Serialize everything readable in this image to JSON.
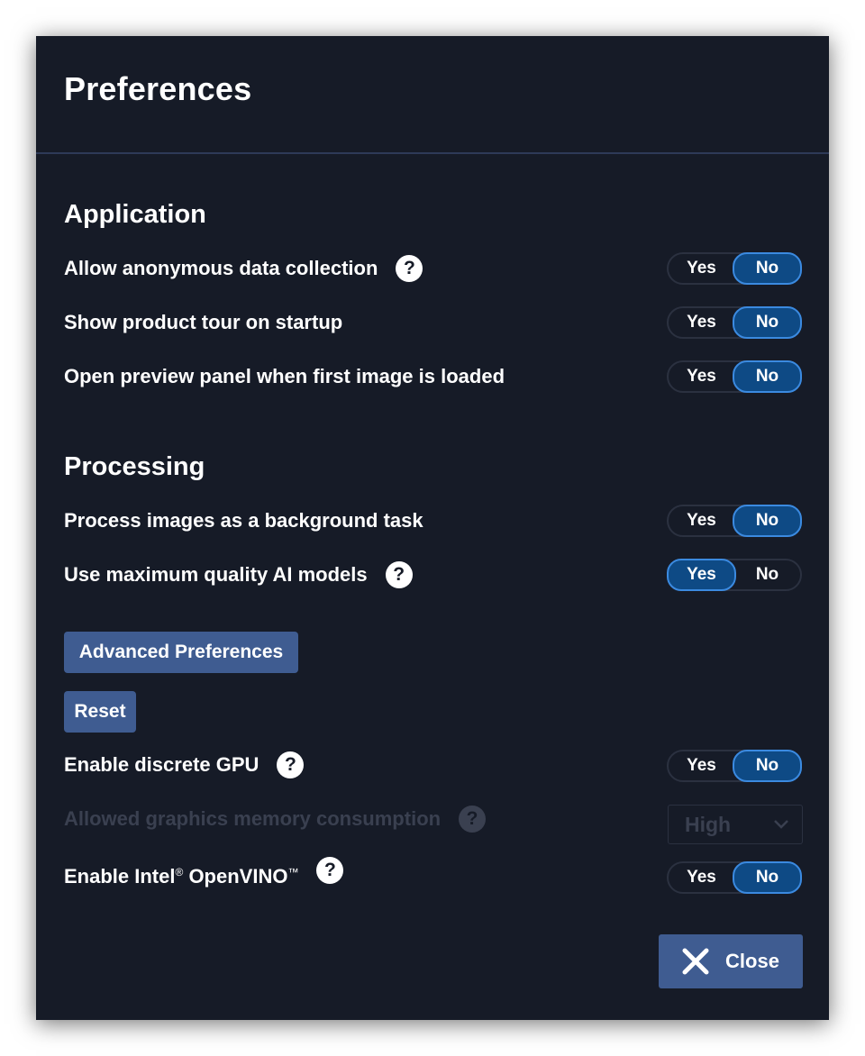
{
  "dialog": {
    "title": "Preferences",
    "close_label": "Close"
  },
  "sections": {
    "application": {
      "title": "Application",
      "rows": [
        {
          "label": "Allow anonymous data collection",
          "help": "?",
          "yes": "Yes",
          "no": "No",
          "selected": "No"
        },
        {
          "label": "Show product tour on startup",
          "yes": "Yes",
          "no": "No",
          "selected": "No"
        },
        {
          "label": "Open preview panel when first image is loaded",
          "yes": "Yes",
          "no": "No",
          "selected": "No"
        }
      ]
    },
    "processing": {
      "title": "Processing",
      "rows": [
        {
          "label": "Process images as a background task",
          "yes": "Yes",
          "no": "No",
          "selected": "No"
        },
        {
          "label": "Use maximum quality AI models",
          "help": "?",
          "yes": "Yes",
          "no": "No",
          "selected": "Yes"
        }
      ],
      "advanced_button": "Advanced Preferences",
      "reset_button": "Reset",
      "advanced_rows": {
        "gpu": {
          "label": "Enable discrete GPU",
          "help": "?",
          "yes": "Yes",
          "no": "No",
          "selected": "No"
        },
        "memory": {
          "label": "Allowed graphics memory consumption",
          "help": "?",
          "value": "High",
          "disabled": true
        },
        "openvino": {
          "label_part1": "Enable Intel",
          "reg": "®",
          "label_part2": " OpenVINO",
          "tm": "™",
          "help": "?",
          "yes": "Yes",
          "no": "No",
          "selected": "No"
        }
      }
    }
  },
  "colors": {
    "background": "#161b27",
    "accent_toggle": "#0e4a85",
    "accent_border": "#3b8ae0",
    "button": "#3f5c91",
    "disabled_text": "#3a4050"
  }
}
